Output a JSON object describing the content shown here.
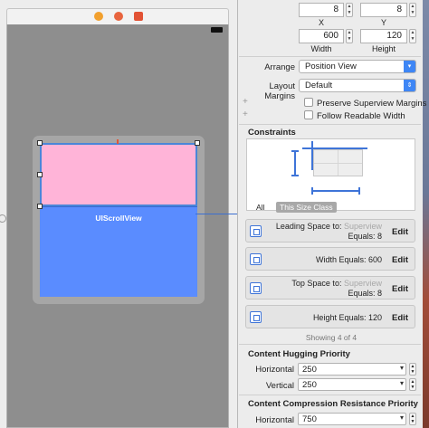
{
  "canvas": {
    "scroll_view_label": "UIScrollView"
  },
  "inspector": {
    "x_value": "8",
    "x_caption": "X",
    "y_value": "8",
    "y_caption": "Y",
    "width_value": "600",
    "width_caption": "Width",
    "height_value": "120",
    "height_caption": "Height",
    "arrange_label": "Arrange",
    "arrange_value": "Position View",
    "margins_label": "Layout Margins",
    "margins_value": "Default",
    "preserve_label": "Preserve Superview Margins",
    "readable_label": "Follow Readable Width",
    "constraints_title": "Constraints",
    "tab_all": "All",
    "tab_this": "This Size Class",
    "constraints": [
      {
        "line1": "Leading Space to:",
        "target": "Superview",
        "line2": "Equals:  8",
        "edit": "Edit"
      },
      {
        "line1": "Width Equals:  600",
        "edit": "Edit"
      },
      {
        "line1": "Top Space to:",
        "target": "Superview",
        "line2": "Equals:  8",
        "edit": "Edit"
      },
      {
        "line1": "Height Equals:  120",
        "edit": "Edit"
      }
    ],
    "showing": "Showing 4 of 4",
    "hugging_title": "Content Hugging Priority",
    "hugging_horizontal_label": "Horizontal",
    "hugging_horizontal_value": "250",
    "hugging_vertical_label": "Vertical",
    "hugging_vertical_value": "250",
    "compression_title": "Content Compression Resistance Priority",
    "compression_horizontal_label": "Horizontal",
    "compression_horizontal_value": "750"
  },
  "colors": {
    "pink_view": "#ffb4d8",
    "scroll_view": "#5a8cff",
    "selection": "#3e74d8"
  },
  "icons": [
    "view-controller-icon",
    "first-responder-icon",
    "exit-icon",
    "battery-icon",
    "constraint-icon"
  ]
}
